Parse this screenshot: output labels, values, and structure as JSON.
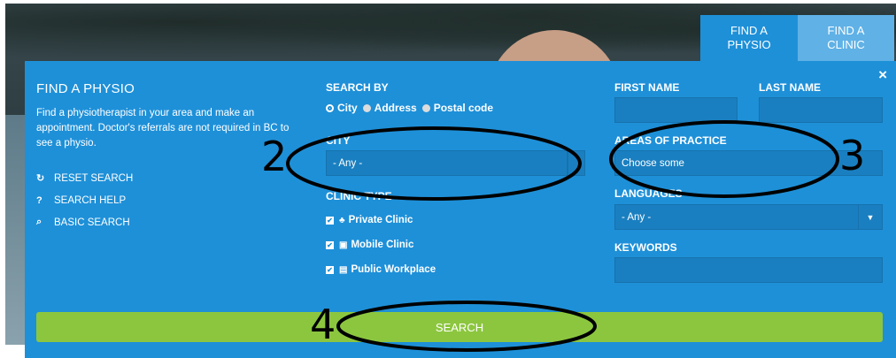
{
  "tabs": {
    "find_physio": "FIND A\nPHYSIO",
    "find_clinic": "FIND A\nCLINIC"
  },
  "panel": {
    "title": "FIND A PHYSIO",
    "description": "Find a physiotherapist in your area and make an appointment. Doctor's referrals are not required in BC to see a physio.",
    "close": "×",
    "side_links": [
      {
        "icon": "↻",
        "label": "RESET SEARCH"
      },
      {
        "icon": "?",
        "label": "SEARCH HELP"
      },
      {
        "icon": "⌕",
        "label": "BASIC SEARCH"
      }
    ]
  },
  "search_by": {
    "label": "SEARCH BY",
    "options": [
      "City",
      "Address",
      "Postal code"
    ],
    "selected": "City"
  },
  "city": {
    "label": "CITY",
    "value": "- Any -"
  },
  "clinic_type": {
    "label": "CLINIC TYPE",
    "options": [
      {
        "icon": "♣",
        "label": "Private Clinic"
      },
      {
        "icon": "▣",
        "label": "Mobile Clinic"
      },
      {
        "icon": "▤",
        "label": "Public Workplace"
      }
    ]
  },
  "first_name": {
    "label": "FIRST NAME",
    "value": ""
  },
  "last_name": {
    "label": "LAST NAME",
    "value": ""
  },
  "areas_of_practice": {
    "label": "AREAS OF PRACTICE",
    "placeholder": "Choose some"
  },
  "languages": {
    "label": "LANGUAGES",
    "value": "- Any -",
    "arrow": "▼"
  },
  "keywords": {
    "label": "KEYWORDS",
    "value": ""
  },
  "search_button": {
    "label": "SEARCH"
  },
  "annotations": [
    "2",
    "3",
    "4"
  ],
  "colors": {
    "panel": "#1e90d8",
    "field": "#1a7fc0",
    "search": "#8cc63f",
    "tab_inactive": "#5fb1e6"
  }
}
